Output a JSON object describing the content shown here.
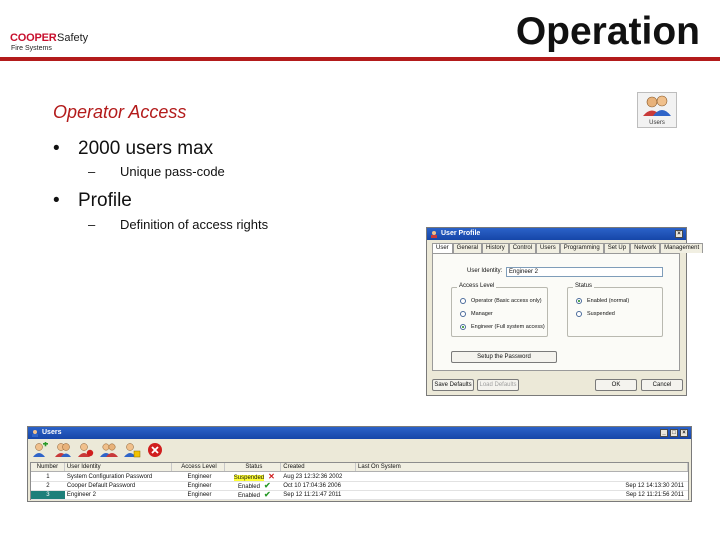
{
  "header": {
    "logo": {
      "brand": "COOPER",
      "brand_suffix": "Safety",
      "division": "Fire Systems"
    },
    "title": "Operation",
    "rule_color": "#b31b1b"
  },
  "content": {
    "section_title": "Operator Access",
    "bullets": [
      {
        "text": "2000 users max",
        "sub": "Unique pass-code"
      },
      {
        "text": "Profile",
        "sub": "Definition of access rights"
      }
    ]
  },
  "users_icon": {
    "icon": "users-icon",
    "label": "Users"
  },
  "user_profile_dialog": {
    "title": "User Profile",
    "tabs": [
      "User",
      "General",
      "History",
      "Control",
      "Users",
      "Programming",
      "Set Up",
      "Network",
      "Management"
    ],
    "active_tab": "User",
    "user_identity_label": "User Identity:",
    "user_identity_value": "Engineer 2",
    "access_level": {
      "title": "Access Level",
      "options": [
        "Operator (Basic access only)",
        "Manager",
        "Engineer (Full system access)"
      ],
      "selected": "Engineer (Full system access)"
    },
    "status": {
      "title": "Status",
      "options": [
        "Enabled (normal)",
        "Suspended"
      ],
      "selected": "Enabled (normal)"
    },
    "buttons": {
      "setup_password": "Setup the Password",
      "save_defaults": "Save Defaults",
      "load_defaults": "Load Defaults",
      "ok": "OK",
      "cancel": "Cancel"
    }
  },
  "users_window": {
    "title": "Users",
    "toolbar_icons": [
      "add-user-icon",
      "edit-user-icon",
      "delete-user-icon",
      "user-group-icon",
      "user-settings-icon",
      "close-icon"
    ],
    "columns": [
      "Number",
      "User Identity",
      "Access Level",
      "Status",
      "Created",
      "Last On System"
    ],
    "rows": [
      {
        "number": "1",
        "identity": "System Configuration Password",
        "level": "Engineer",
        "status": "Suspended",
        "created": "Aug 23 12:32:36 2002",
        "last_on": "",
        "mark": "x"
      },
      {
        "number": "2",
        "identity": "Cooper Default Password",
        "level": "Engineer",
        "status": "Enabled",
        "created": "Oct 10 17:04:36 2006",
        "last_on": "Sep 12 14:13:30 2011",
        "mark": "check"
      },
      {
        "number": "3",
        "identity": "Engineer 2",
        "level": "Engineer",
        "status": "Enabled",
        "created": "Sep 12 11:21:47 2011",
        "last_on": "Sep 12 11:21:56 2011",
        "mark": "check"
      }
    ],
    "selected_row": "3",
    "colors": {
      "suspended_bg": "#ffff33",
      "selected_bg": "#1d7f7a",
      "check": "#2a9a2a",
      "cross": "#d01e1e"
    }
  }
}
